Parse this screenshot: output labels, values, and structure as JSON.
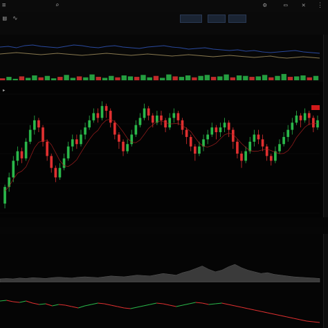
{
  "window": {
    "title": "",
    "symbol": ""
  },
  "toolbar": {
    "tabs": [
      "",
      "",
      ""
    ]
  },
  "icons": [
    "menu-icon",
    "search-icon",
    "settings-icon",
    "close-icon",
    "chart-type-icon",
    "indicator-icon"
  ],
  "main_chart": {
    "last_price_badge": ""
  },
  "x_axis": {
    "ticks": []
  },
  "colors": {
    "up": "#2ab84a",
    "down": "#e03030",
    "ma": "#b02020",
    "overview_line_blue": "#2a4aa0",
    "overview_line_tan": "#8a7a50",
    "background": "#030303",
    "accent": "#d11a1a"
  },
  "chart_data": [
    {
      "type": "candlestick",
      "title": "",
      "xlabel": "",
      "ylabel": "",
      "ylim": [
        0,
        100
      ],
      "candles": [
        [
          8,
          22,
          4,
          24
        ],
        [
          22,
          30,
          18,
          34
        ],
        [
          30,
          44,
          26,
          48
        ],
        [
          44,
          52,
          40,
          56
        ],
        [
          52,
          46,
          42,
          55
        ],
        [
          46,
          60,
          44,
          63
        ],
        [
          60,
          70,
          58,
          74
        ],
        [
          70,
          78,
          66,
          82
        ],
        [
          78,
          72,
          68,
          80
        ],
        [
          72,
          60,
          56,
          74
        ],
        [
          60,
          48,
          44,
          62
        ],
        [
          48,
          38,
          34,
          50
        ],
        [
          38,
          30,
          26,
          40
        ],
        [
          30,
          38,
          28,
          42
        ],
        [
          38,
          46,
          36,
          50
        ],
        [
          46,
          56,
          44,
          60
        ],
        [
          56,
          62,
          52,
          66
        ],
        [
          62,
          58,
          54,
          66
        ],
        [
          58,
          66,
          56,
          70
        ],
        [
          66,
          72,
          62,
          76
        ],
        [
          72,
          78,
          70,
          82
        ],
        [
          78,
          84,
          76,
          88
        ],
        [
          84,
          80,
          76,
          88
        ],
        [
          80,
          90,
          78,
          94
        ],
        [
          90,
          86,
          80,
          92
        ],
        [
          86,
          76,
          72,
          88
        ],
        [
          76,
          66,
          62,
          78
        ],
        [
          66,
          60,
          54,
          68
        ],
        [
          60,
          52,
          48,
          62
        ],
        [
          52,
          58,
          50,
          62
        ],
        [
          58,
          66,
          56,
          70
        ],
        [
          66,
          74,
          64,
          78
        ],
        [
          74,
          80,
          72,
          84
        ],
        [
          80,
          88,
          78,
          92
        ],
        [
          88,
          82,
          78,
          90
        ],
        [
          82,
          76,
          72,
          84
        ],
        [
          76,
          82,
          74,
          86
        ],
        [
          82,
          78,
          74,
          86
        ],
        [
          78,
          72,
          68,
          80
        ],
        [
          72,
          80,
          70,
          84
        ],
        [
          80,
          84,
          76,
          88
        ],
        [
          84,
          78,
          74,
          86
        ],
        [
          78,
          70,
          66,
          80
        ],
        [
          70,
          64,
          58,
          72
        ],
        [
          64,
          56,
          52,
          66
        ],
        [
          56,
          50,
          44,
          58
        ],
        [
          50,
          56,
          48,
          60
        ],
        [
          56,
          62,
          52,
          66
        ],
        [
          62,
          66,
          58,
          70
        ],
        [
          66,
          72,
          64,
          76
        ],
        [
          72,
          68,
          62,
          74
        ],
        [
          68,
          72,
          64,
          76
        ],
        [
          72,
          76,
          68,
          80
        ],
        [
          76,
          70,
          64,
          78
        ],
        [
          70,
          60,
          54,
          72
        ],
        [
          60,
          50,
          46,
          62
        ],
        [
          50,
          44,
          38,
          52
        ],
        [
          44,
          52,
          42,
          56
        ],
        [
          52,
          60,
          50,
          64
        ],
        [
          60,
          66,
          56,
          70
        ],
        [
          66,
          62,
          58,
          70
        ],
        [
          62,
          56,
          52,
          66
        ],
        [
          56,
          48,
          44,
          58
        ],
        [
          48,
          44,
          40,
          50
        ],
        [
          44,
          52,
          42,
          56
        ],
        [
          52,
          58,
          50,
          62
        ],
        [
          58,
          64,
          56,
          68
        ],
        [
          64,
          70,
          60,
          74
        ],
        [
          70,
          76,
          66,
          80
        ],
        [
          76,
          82,
          74,
          86
        ],
        [
          82,
          78,
          72,
          84
        ],
        [
          78,
          84,
          76,
          88
        ],
        [
          84,
          80,
          74,
          86
        ],
        [
          80,
          72,
          68,
          82
        ],
        [
          72,
          78,
          70,
          82
        ]
      ]
    },
    {
      "type": "line",
      "title": "",
      "xlabel": "",
      "ylabel": "",
      "ylim": [
        0,
        100
      ],
      "series": [
        {
          "name": "",
          "values": [
            60,
            62,
            58,
            64,
            66,
            62,
            60,
            58,
            62,
            66,
            64,
            60,
            58,
            62,
            64,
            60,
            58,
            56,
            60,
            62,
            64,
            60,
            58,
            54,
            56,
            58,
            54,
            52,
            50,
            52,
            48,
            50,
            46,
            44,
            46,
            48,
            50,
            46,
            44,
            42
          ]
        },
        {
          "name": "",
          "values": [
            40,
            42,
            44,
            42,
            40,
            38,
            40,
            42,
            40,
            38,
            36,
            38,
            40,
            42,
            40,
            38,
            36,
            38,
            40,
            38,
            36,
            34,
            36,
            38,
            36,
            34,
            32,
            34,
            36,
            34,
            32,
            30,
            32,
            34,
            30,
            28,
            30,
            32,
            30,
            28
          ]
        }
      ]
    },
    {
      "type": "bar",
      "title": "",
      "xlabel": "",
      "ylabel": "",
      "ylim": [
        0,
        100
      ],
      "values": [
        20,
        35,
        15,
        40,
        25,
        50,
        30,
        45,
        20,
        35,
        55,
        25,
        40,
        30,
        60,
        35,
        25,
        45,
        30,
        50,
        40,
        35,
        55,
        30,
        45,
        25,
        60,
        40,
        35,
        50,
        30,
        45,
        55,
        35,
        40,
        60,
        30,
        50,
        45,
        35,
        40,
        55,
        30,
        45,
        65,
        35,
        40,
        50,
        30,
        45
      ]
    },
    {
      "type": "area",
      "title": "",
      "xlabel": "",
      "ylabel": "",
      "ylim": [
        0,
        100
      ],
      "values": [
        5,
        6,
        5,
        7,
        6,
        8,
        7,
        6,
        8,
        9,
        8,
        7,
        9,
        10,
        9,
        8,
        10,
        12,
        11,
        10,
        12,
        14,
        13,
        12,
        15,
        18,
        16,
        14,
        20,
        24,
        30,
        36,
        28,
        22,
        26,
        34,
        40,
        32,
        26,
        22,
        18,
        20,
        16,
        14,
        12,
        10,
        9,
        8,
        7,
        6
      ]
    },
    {
      "type": "line",
      "title": "",
      "xlabel": "",
      "ylabel": "",
      "ylim": [
        0,
        100
      ],
      "values": [
        70,
        72,
        68,
        66,
        70,
        64,
        60,
        62,
        56,
        60,
        58,
        54,
        50,
        56,
        60,
        64,
        62,
        58,
        54,
        50,
        48,
        52,
        56,
        60,
        64,
        62,
        58,
        54,
        58,
        62,
        66,
        64,
        60,
        62,
        64,
        60,
        56,
        52,
        48,
        44,
        40,
        36,
        32,
        28,
        24,
        20,
        16,
        12,
        10,
        8
      ]
    }
  ]
}
